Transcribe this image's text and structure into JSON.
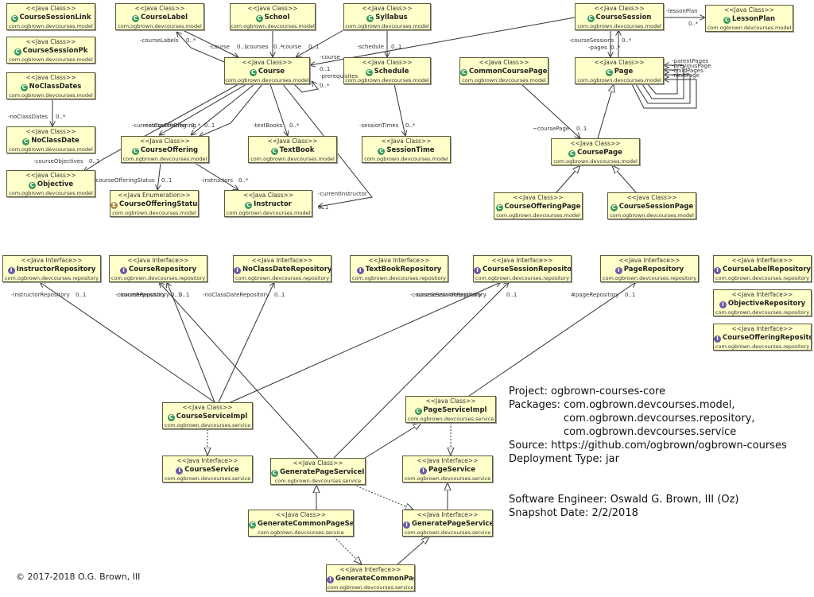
{
  "boxes": [
    {
      "id": "CourseSessionLink",
      "stereotype": "<<Java Class>>",
      "name": "CourseSessionLink",
      "package": "com.ogbrown.devcourses.model",
      "kind": "C"
    },
    {
      "id": "CourseSessionPk",
      "stereotype": "<<Java Class>>",
      "name": "CourseSessionPk",
      "package": "com.ogbrown.devcourses.model",
      "kind": "C"
    },
    {
      "id": "NoClassDates",
      "stereotype": "<<Java Class>>",
      "name": "NoClassDates",
      "package": "com.ogbrown.devcourses.model",
      "kind": "C"
    },
    {
      "id": "NoClassDate",
      "stereotype": "<<Java Class>>",
      "name": "NoClassDate",
      "package": "com.ogbrown.devcourses.model",
      "kind": "C"
    },
    {
      "id": "Objective",
      "stereotype": "<<Java Class>>",
      "name": "Objective",
      "package": "com.ogbrown.devcourses.model",
      "kind": "C"
    },
    {
      "id": "CourseLabel",
      "stereotype": "<<Java Class>>",
      "name": "CourseLabel",
      "package": "com.ogbrown.devcourses.model",
      "kind": "C"
    },
    {
      "id": "School",
      "stereotype": "<<Java Class>>",
      "name": "School",
      "package": "com.ogbrown.devcourses.model",
      "kind": "C"
    },
    {
      "id": "Syllabus",
      "stereotype": "<<Java Class>>",
      "name": "Syllabus",
      "package": "com.ogbrown.devcourses.model",
      "kind": "C"
    },
    {
      "id": "Course",
      "stereotype": "<<Java Class>>",
      "name": "Course",
      "package": "com.ogbrown.devcourses.model",
      "kind": "C"
    },
    {
      "id": "Schedule",
      "stereotype": "<<Java Class>>",
      "name": "Schedule",
      "package": "com.ogbrown.devcourses.model",
      "kind": "C"
    },
    {
      "id": "CourseOffering",
      "stereotype": "<<Java Class>>",
      "name": "CourseOffering",
      "package": "com.ogbrown.devcourses.model",
      "kind": "C"
    },
    {
      "id": "TextBook",
      "stereotype": "<<Java Class>>",
      "name": "TextBook",
      "package": "com.ogbrown.devcourses.model",
      "kind": "C"
    },
    {
      "id": "SessionTime",
      "stereotype": "<<Java Class>>",
      "name": "SessionTime",
      "package": "com.ogbrown.devcourses.model",
      "kind": "C"
    },
    {
      "id": "CourseOfferingStatus",
      "stereotype": "<<Java Enumeration>>",
      "name": "CourseOfferingStatus",
      "package": "com.ogbrown.devcourses.model",
      "kind": "E"
    },
    {
      "id": "Instructor",
      "stereotype": "<<Java Class>>",
      "name": "Instructor",
      "package": "com.ogbrown.devcourses.model",
      "kind": "C"
    },
    {
      "id": "CourseSession",
      "stereotype": "<<Java Class>>",
      "name": "CourseSession",
      "package": "com.ogbrown.devcourses.model",
      "kind": "C"
    },
    {
      "id": "LessonPlan",
      "stereotype": "<<Java Class>>",
      "name": "LessonPlan",
      "package": "com.ogbrown.devcourses.model",
      "kind": "C"
    },
    {
      "id": "CommonCoursePages",
      "stereotype": "<<Java Class>>",
      "name": "CommonCoursePages",
      "package": "com.ogbrown.devcourses.model",
      "kind": "C"
    },
    {
      "id": "Page",
      "stereotype": "<<Java Class>>",
      "name": "Page",
      "package": "com.ogbrown.devcourses.model",
      "kind": "C"
    },
    {
      "id": "CoursePage",
      "stereotype": "<<Java Class>>",
      "name": "CoursePage",
      "package": "com.ogbrown.devcourses.model",
      "kind": "C"
    },
    {
      "id": "CourseOfferingPage",
      "stereotype": "<<Java Class>>",
      "name": "CourseOfferingPage",
      "package": "com.ogbrown.devcourses.model",
      "kind": "C"
    },
    {
      "id": "CourseSessionPage",
      "stereotype": "<<Java Class>>",
      "name": "CourseSessionPage",
      "package": "com.ogbrown.devcourses.model",
      "kind": "C"
    },
    {
      "id": "InstructorRepository",
      "stereotype": "<<Java Interface>>",
      "name": "InstructorRepository",
      "package": "com.ogbrown.devcourses.repository",
      "kind": "I"
    },
    {
      "id": "CourseRepository",
      "stereotype": "<<Java Interface>>",
      "name": "CourseRepository",
      "package": "com.ogbrown.devcourses.repository",
      "kind": "I"
    },
    {
      "id": "NoClassDateRepository",
      "stereotype": "<<Java Interface>>",
      "name": "NoClassDateRepository",
      "package": "com.ogbrown.devcourses.repository",
      "kind": "I"
    },
    {
      "id": "TextBookRepository",
      "stereotype": "<<Java Interface>>",
      "name": "TextBookRepository",
      "package": "com.ogbrown.devcourses.repository",
      "kind": "I"
    },
    {
      "id": "CourseSessionRepository",
      "stereotype": "<<Java Interface>>",
      "name": "CourseSessionRepository",
      "package": "com.ogbrown.devcourses.repository",
      "kind": "I"
    },
    {
      "id": "PageRepository",
      "stereotype": "<<Java Interface>>",
      "name": "PageRepository",
      "package": "com.ogbrown.devcourses.repository",
      "kind": "I"
    },
    {
      "id": "CourseLabelRepository",
      "stereotype": "<<Java Interface>>",
      "name": "CourseLabelRepository",
      "package": "com.ogbrown.devcourses.repository",
      "kind": "I"
    },
    {
      "id": "ObjectiveRepository",
      "stereotype": "<<Java Interface>>",
      "name": "ObjectiveRepository",
      "package": "com.ogbrown.devcourses.repository",
      "kind": "I"
    },
    {
      "id": "CourseOfferingRepository",
      "stereotype": "<<Java Interface>>",
      "name": "CourseOfferingRepository",
      "package": "com.ogbrown.devcourses.repository",
      "kind": "I"
    },
    {
      "id": "CourseServiceImpl",
      "stereotype": "<<Java Class>>",
      "name": "CourseServiceImpl",
      "package": "com.ogbrown.devcourses.service",
      "kind": "C"
    },
    {
      "id": "PageServiceImpl",
      "stereotype": "<<Java Class>>",
      "name": "PageServiceImpl",
      "package": "com.ogbrown.devcourses.service",
      "kind": "C"
    },
    {
      "id": "CourseService",
      "stereotype": "<<Java Interface>>",
      "name": "CourseService",
      "package": "com.ogbrown.devcourses.service",
      "kind": "I"
    },
    {
      "id": "GeneratePageServiceImpl",
      "stereotype": "<<Java Class>>",
      "name": "GeneratePageServiceImpl",
      "package": "com.ogbrown.devcourses.service",
      "kind": "C"
    },
    {
      "id": "PageService",
      "stereotype": "<<Java Interface>>",
      "name": "PageService",
      "package": "com.ogbrown.devcourses.service",
      "kind": "I"
    },
    {
      "id": "GenerateCommonPageServiceImpl",
      "stereotype": "<<Java Class>>",
      "name": "GenerateCommonPageServiceImpl",
      "package": "com.ogbrown.devcourses.service",
      "kind": "C"
    },
    {
      "id": "GeneratePageService",
      "stereotype": "<<Java Interface>>",
      "name": "GeneratePageService",
      "package": "com.ogbrown.devcourses.service",
      "kind": "I"
    },
    {
      "id": "GenerateCommonPageService",
      "stereotype": "<<Java Interface>>",
      "name": "GenerateCommonPageService",
      "package": "com.ogbrown.devcourses.service",
      "kind": "I"
    }
  ],
  "edge_labels": [
    "-courseLabels",
    "0..*",
    "-course",
    "0..1",
    "-courses",
    "0..*",
    "-course",
    "0..1",
    "-schedule",
    "0..1",
    "-course",
    "0..1",
    "-prerequisites",
    "0..*",
    "-noClassDates",
    "0..*",
    "-courseObjectives",
    "0..1",
    "-currentCourseOffering",
    "-courseOffering",
    "0..*",
    "0..1",
    "-textBooks",
    "0..*",
    "-sessionTimes",
    "0..*",
    "-courseOfferingStatus",
    "0..1",
    "-instructors",
    "0..*",
    "-currentInstructor",
    "0..1",
    "-lessonPlan",
    "0..*",
    "-courseSessions",
    "-pages",
    "0..*",
    "0..*",
    "-parentPages",
    "-previousPage",
    "-childPages",
    "-nextPage",
    "~coursePage",
    "0..1",
    "-instructorRepository",
    "0..1",
    "-courseRepository",
    "-courseRepository",
    "0..1",
    "0..1",
    "-noClassDateRepository",
    "0..1",
    "-courseSessionRepository",
    "-courseSessionRepository",
    "0..1",
    "#pageRepository",
    "0..1"
  ],
  "info": {
    "project": "Project: ogbrown-courses-core",
    "packages_1": "Packages: com.ogbrown.devcourses.model,",
    "packages_2": "com.ogbrown.devcourses.repository,",
    "packages_3": "com.ogbrown.devcourses.service",
    "source": "Source: https://github.com/ogbrown/ogbrown-courses",
    "deployment": "Deployment Type: jar",
    "engineer": "Software Engineer: Oswald G. Brown, III (Oz)",
    "snapshot": "Snapshot Date: 2/2/2018"
  },
  "copyright": "© 2017-2018 O.G. Brown, III",
  "colors": {
    "box_fill": "#ffffca",
    "class_icon": "#3a9a5a",
    "interface_icon": "#6a5aa8",
    "enum_icon": "#a88a40"
  }
}
